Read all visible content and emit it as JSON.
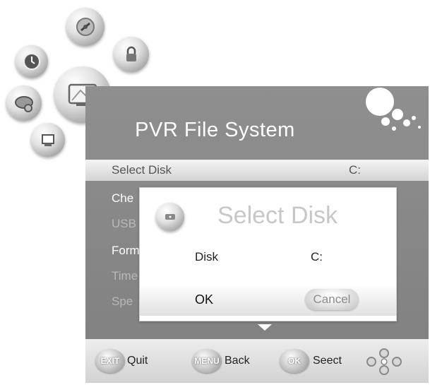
{
  "header": {
    "title": "PVR File System"
  },
  "menu": {
    "items": [
      {
        "label": "Select Disk",
        "value": "C:"
      },
      {
        "label": "Che",
        "value": ""
      },
      {
        "label": "USB",
        "value": ""
      },
      {
        "label": "Form",
        "value": ""
      },
      {
        "label": "Time",
        "value": ""
      },
      {
        "label": "Spe",
        "value": ""
      }
    ],
    "selected_index": 0
  },
  "dialog": {
    "title": "Select Disk",
    "field_label": "Disk",
    "field_value": "C:",
    "ok_label": "OK",
    "cancel_label": "Cancel"
  },
  "footer": {
    "exit": {
      "key": "EXIT",
      "label": "Quit"
    },
    "menu": {
      "key": "MENU",
      "label": "Back"
    },
    "ok": {
      "key": "OK",
      "label": "Seect"
    }
  },
  "radial_icons": [
    "clock-icon",
    "tv-settings-icon",
    "lock-icon",
    "disc-icon",
    "pvr-screen-icon",
    "media-icon"
  ],
  "colors": {
    "panel": "#8a8a8a",
    "selected_row": "#e4e4e4",
    "dialog": "#ffffff",
    "footer": "#e0e0e0"
  }
}
